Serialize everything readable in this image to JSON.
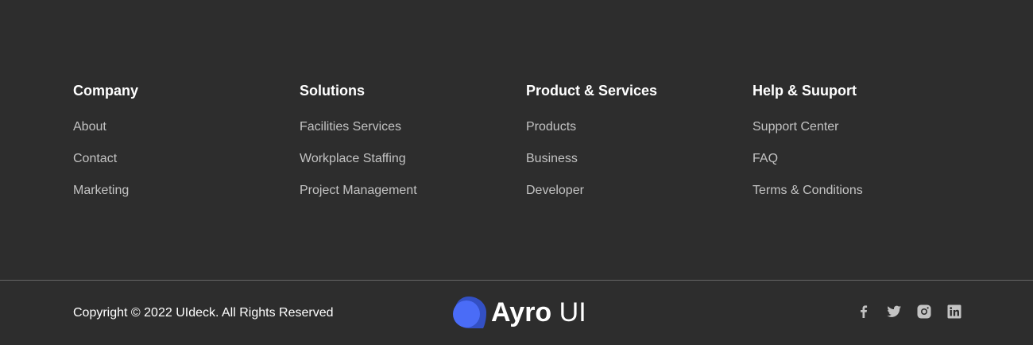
{
  "columns": [
    {
      "title": "Company",
      "links": [
        "About",
        "Contact",
        "Marketing"
      ]
    },
    {
      "title": "Solutions",
      "links": [
        "Facilities Services",
        "Workplace Staffing",
        "Project Management"
      ]
    },
    {
      "title": "Product & Services",
      "links": [
        "Products",
        "Business",
        "Developer"
      ]
    },
    {
      "title": "Help & Suuport",
      "links": [
        "Support Center",
        "FAQ",
        "Terms & Conditions"
      ]
    }
  ],
  "copyright": "Copyright © 2022 UIdeck. All Rights Reserved",
  "logo": {
    "strong": "Ayro",
    "light": "UI"
  },
  "social": [
    "facebook-icon",
    "twitter-icon",
    "instagram-icon",
    "linkedin-icon"
  ],
  "colors": {
    "background": "#2d2d2d",
    "heading": "#ffffff",
    "link": "#c3c3c3",
    "divider": "#666666",
    "logo_front": "#4a6cf7",
    "logo_back": "#3350c4",
    "icon": "#c3c3c3"
  }
}
